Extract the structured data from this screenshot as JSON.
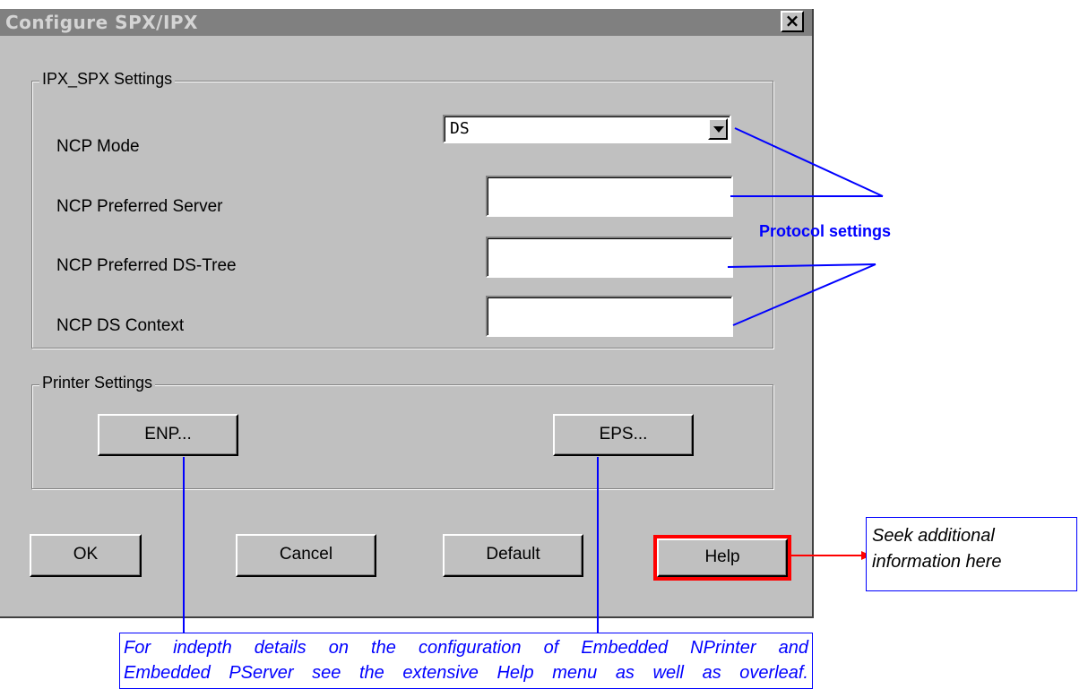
{
  "window": {
    "title": "Configure SPX/IPX",
    "close_glyph": "×"
  },
  "ipx_group": {
    "legend": "IPX_SPX Settings",
    "ncp_mode": {
      "label": "NCP Mode",
      "value": "DS"
    },
    "preferred_server": {
      "label": "NCP Preferred Server",
      "value": ""
    },
    "preferred_ds_tree": {
      "label": "NCP Preferred DS-Tree",
      "value": ""
    },
    "ds_context": {
      "label": "NCP DS Context",
      "value": ""
    }
  },
  "printer_group": {
    "legend": "Printer Settings",
    "enp_label": "ENP...",
    "eps_label": "EPS..."
  },
  "footer": {
    "ok_label": "OK",
    "cancel_label": "Cancel",
    "default_label": "Default",
    "help_label": "Help"
  },
  "annotations": {
    "protocol_label": "Protocol settings",
    "help_note": [
      "Seek additional",
      "information here"
    ],
    "bottom_note": [
      "For indepth details on the configuration of Embedded NPrinter and",
      "Embedded PServer see the extensive Help menu as well as overleaf."
    ],
    "colors": {
      "callout_blue": "#0000ff",
      "highlight_red": "#ff0000"
    }
  }
}
